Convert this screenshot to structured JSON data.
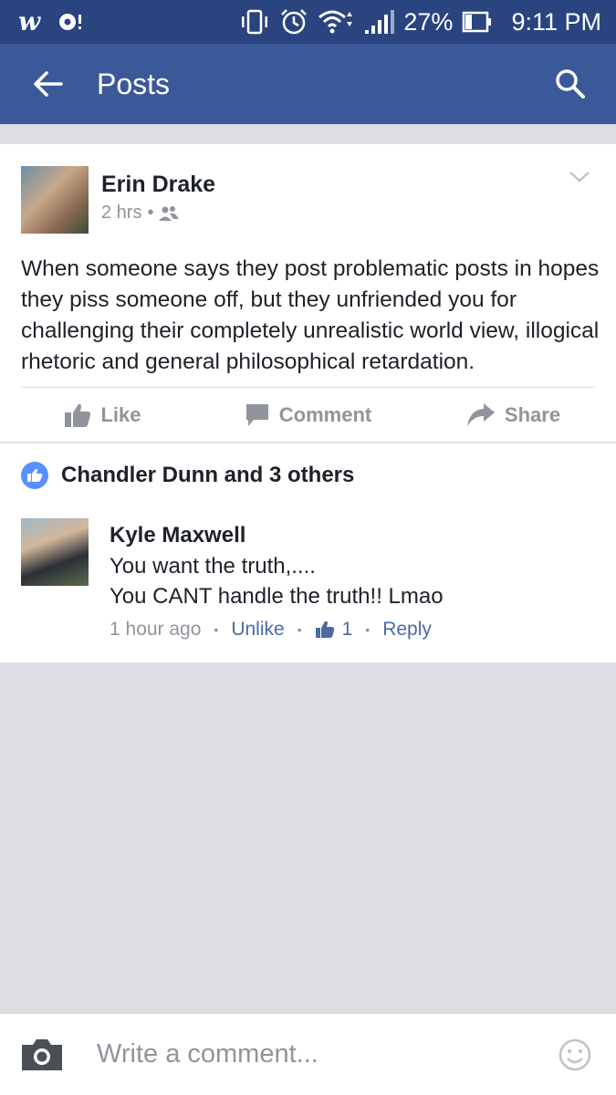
{
  "status_bar": {
    "battery_percent": "27%",
    "time": "9:11 PM",
    "icons": [
      "wish-app-icon",
      "notification-icon",
      "vibrate-icon",
      "alarm-icon",
      "wifi-icon",
      "signal-icon",
      "battery-icon"
    ]
  },
  "app_bar": {
    "title": "Posts"
  },
  "post": {
    "author": "Erin Drake",
    "time": "2 hrs",
    "privacy": "friends",
    "text": "When someone says they post problematic posts in hopes they piss someone off, but they unfriended you for challenging their completely unrealistic world view, illogical rhetoric and general philosophical retardation.",
    "actions": {
      "like": "Like",
      "comment": "Comment",
      "share": "Share"
    }
  },
  "likes": {
    "text": "Chandler Dunn and 3 others"
  },
  "comment": {
    "author": "Kyle Maxwell",
    "line1": "You want the truth,....",
    "line2": "You CANT handle the truth!! Lmao",
    "time": "1 hour ago",
    "unlike": "Unlike",
    "like_count": "1",
    "reply": "Reply"
  },
  "composer": {
    "placeholder": "Write a comment..."
  },
  "colors": {
    "status_bar": "#2a4480",
    "app_bar": "#3b5998",
    "like_badge": "#5890ff",
    "link": "#4b6aa6",
    "muted": "#90949c"
  }
}
